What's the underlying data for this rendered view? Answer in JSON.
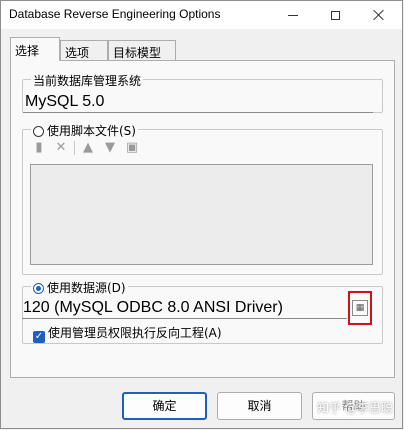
{
  "window": {
    "title": "Database Reverse Engineering Options"
  },
  "tabs": [
    {
      "label": "选择",
      "active": true
    },
    {
      "label": "选项",
      "active": false
    },
    {
      "label": "目标模型",
      "active": false
    }
  ],
  "dbms": {
    "label": "当前数据库管理系统",
    "value": "MySQL 5.0"
  },
  "script_files": {
    "label": "使用脚本文件(S)",
    "selected": false,
    "toolbar_icons": [
      "add-file-icon",
      "delete-icon",
      "move-up-icon",
      "move-down-icon",
      "script-icon"
    ]
  },
  "data_source": {
    "label": "使用数据源(D)",
    "selected": true,
    "value": "120 (MySQL ODBC 8.0 ANSI Driver)",
    "browse_icon": "database-connect-icon"
  },
  "admin": {
    "label": "使用管理员权限执行反向工程(A)",
    "checked": true
  },
  "buttons": {
    "ok": "确定",
    "cancel": "取消",
    "help": "帮助"
  },
  "watermark": "知乎 @李思聪",
  "colors": {
    "accent": "#1f5fbf",
    "highlight_border": "#d0121b"
  }
}
